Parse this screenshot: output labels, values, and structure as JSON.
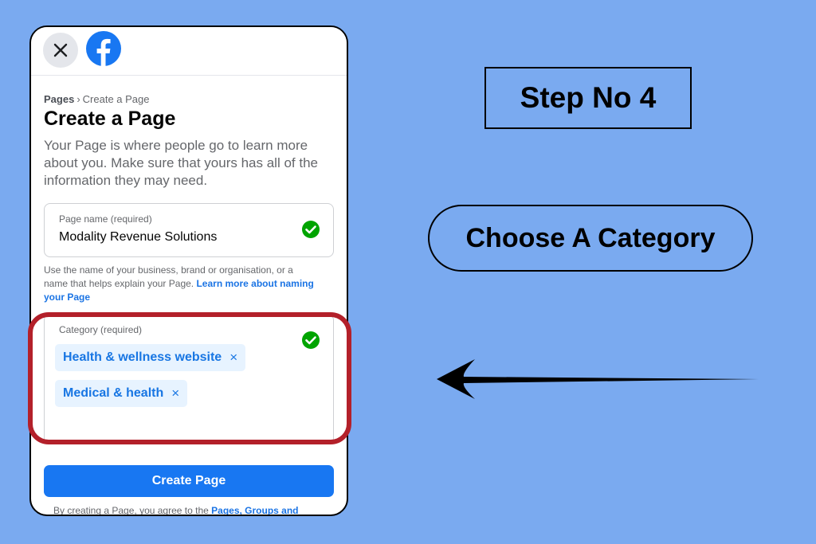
{
  "header": {
    "close_icon": "close-icon",
    "logo_icon": "facebook-logo-icon"
  },
  "breadcrumb": {
    "root": "Pages",
    "separator": "›",
    "current": "Create a Page"
  },
  "page": {
    "title": "Create a Page",
    "description": "Your Page is where people go to learn more about you. Make sure that yours has all of the information they may need."
  },
  "page_name_field": {
    "label": "Page name (required)",
    "value": "Modality Revenue Solutions",
    "status_icon": "check-circle-icon"
  },
  "helper": {
    "text": "Use the name of your business, brand or organisation, or a name that helps explain your Page.",
    "link": "Learn more about naming your Page"
  },
  "category_field": {
    "label": "Category (required)",
    "status_icon": "check-circle-icon",
    "chips": [
      {
        "label": "Health & wellness website",
        "remove": "×"
      },
      {
        "label": "Medical & health",
        "remove": "×"
      }
    ]
  },
  "create_button": {
    "label": "Create Page"
  },
  "terms": {
    "text": "By creating a Page, you agree to the",
    "link": "Pages, Groups and"
  },
  "annotations": {
    "step": "Step No 4",
    "instruction": "Choose A Category",
    "highlight_color": "#b3202a",
    "arrow_icon": "left-arrow-icon"
  },
  "colors": {
    "background": "#7aaaf0",
    "accent": "#1877f2",
    "chip_bg": "#e7f3ff",
    "success": "#00a400"
  }
}
